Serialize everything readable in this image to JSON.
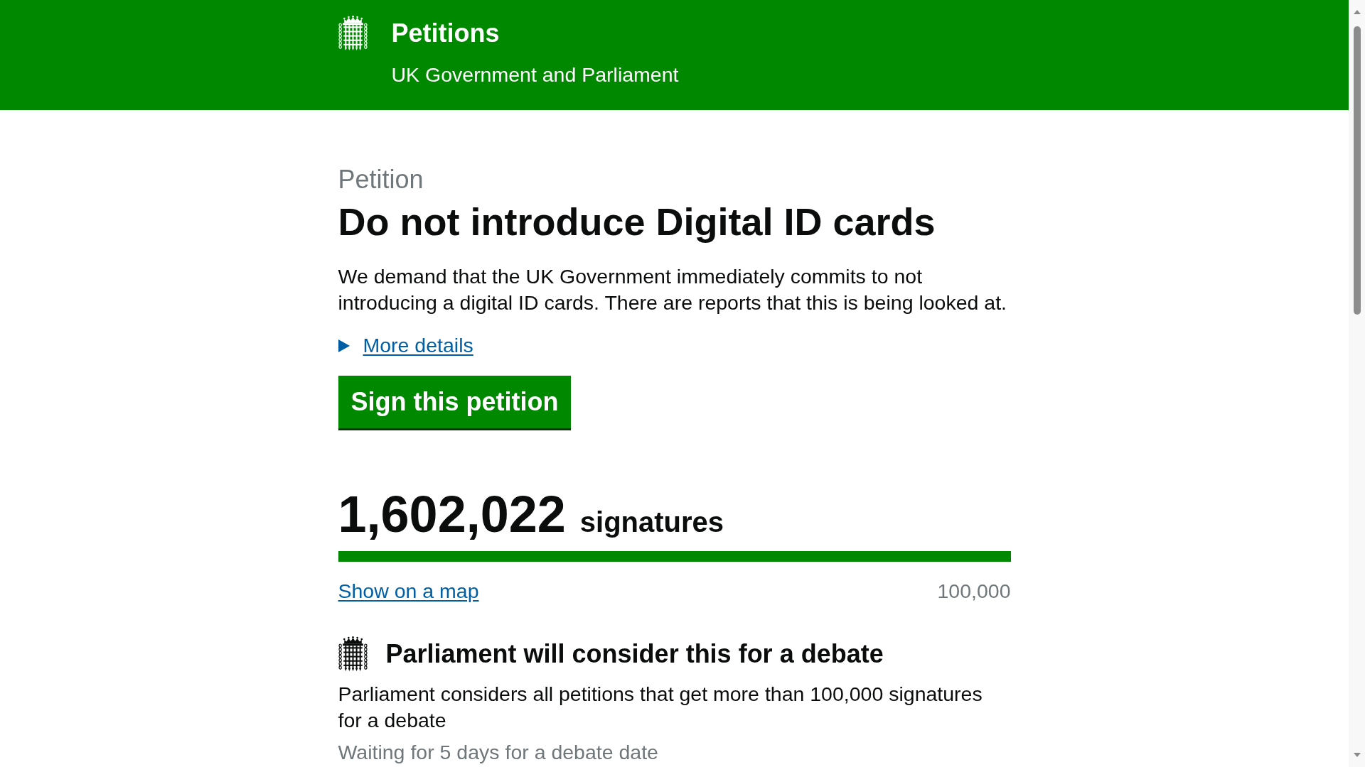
{
  "header": {
    "title": "Petitions",
    "subtitle": "UK Government and Parliament"
  },
  "petition": {
    "caption": "Petition",
    "title": "Do not introduce Digital ID cards",
    "summary": "We demand that the UK Government immediately commits to not introducing a digital ID cards. There are reports that this is being looked at.",
    "details": {
      "label": "More details",
      "expanded": false
    },
    "sign_button": "Sign this petition"
  },
  "signatures": {
    "count": "1,602,022",
    "unit": "signatures",
    "level": 1,
    "map_link": "Show on a map",
    "threshold": "100,000"
  },
  "debate": {
    "heading": "Parliament will consider this for a debate",
    "text": "Parliament considers all petitions that get more than 100,000 signatures for a debate",
    "status": "Waiting for 5 days for a debate date"
  }
}
